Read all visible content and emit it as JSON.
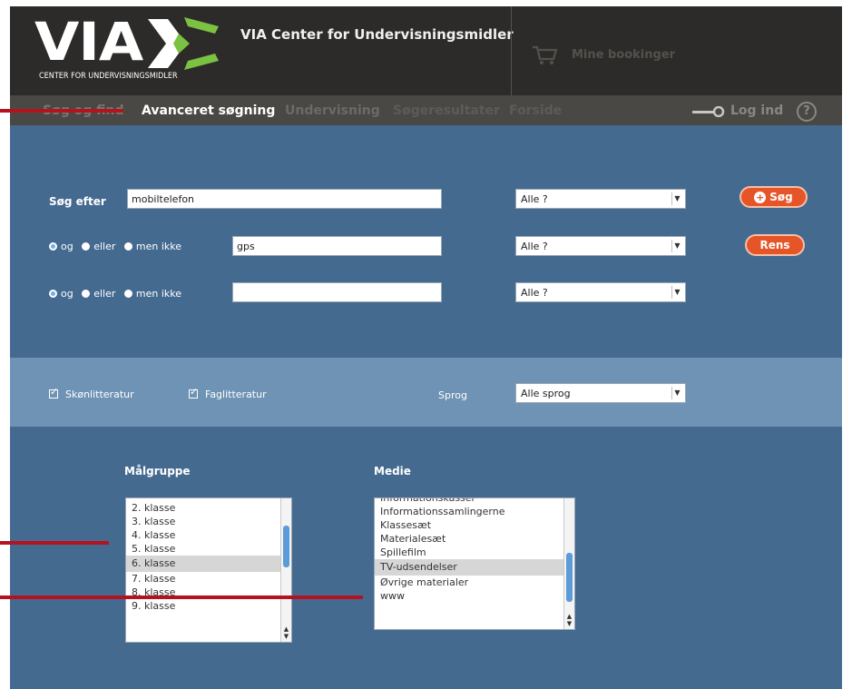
{
  "header": {
    "logo_text": "VIA",
    "logo_subtitle": "CENTER FOR UNDERVISNINGSMIDLER",
    "center_title": "VIA Center for Undervisningsmidler",
    "bookings_label": "Mine bookinger",
    "cart_icon": "shopping-cart-icon"
  },
  "nav": {
    "items": [
      {
        "label": "Søg og find",
        "active": false
      },
      {
        "label": "Avanceret søgning",
        "active": true
      },
      {
        "label": "Undervisning",
        "active": false
      },
      {
        "label": "Søgeresultater",
        "active": false
      },
      {
        "label": "Forside",
        "active": false
      }
    ],
    "login_label": "Log ind",
    "help_label": "?"
  },
  "search": {
    "search_for_label": "Søg efter",
    "rows": [
      {
        "term": "mobiltelefon",
        "scope": "Alle ?"
      },
      {
        "term": "gps",
        "scope": "Alle ?"
      },
      {
        "term": "",
        "scope": "Alle ?"
      }
    ],
    "operators": [
      "og",
      "eller",
      "men ikke"
    ],
    "search_button": "Søg",
    "clear_button": "Rens"
  },
  "filters": {
    "fiction_label": "Skønlitteratur",
    "nonfiction_label": "Faglitteratur",
    "language_label": "Sprog",
    "language_value": "Alle sprog"
  },
  "target_group": {
    "heading": "Målgruppe",
    "items": [
      "2. klasse",
      "3. klasse",
      "4. klasse",
      "5. klasse",
      "6. klasse",
      "7. klasse",
      "8. klasse",
      "9. klasse"
    ],
    "selected_index": 4
  },
  "media": {
    "heading": "Medie",
    "items": [
      "Informationskasser",
      "Informationssamlingerne",
      "Klassesæt",
      "Materialesæt",
      "Spillefilm",
      "TV-udsendelser",
      "Øvrige materialer",
      "www"
    ],
    "selected_index": 5
  },
  "colors": {
    "header_bg": "#2d2b29",
    "nav_bg": "#4a4845",
    "panel_bg": "#456a90",
    "band_bg": "#6f93b4",
    "button_orange": "#e65528",
    "annotation_red": "#b5121f",
    "logo_green": "#7cc242"
  }
}
